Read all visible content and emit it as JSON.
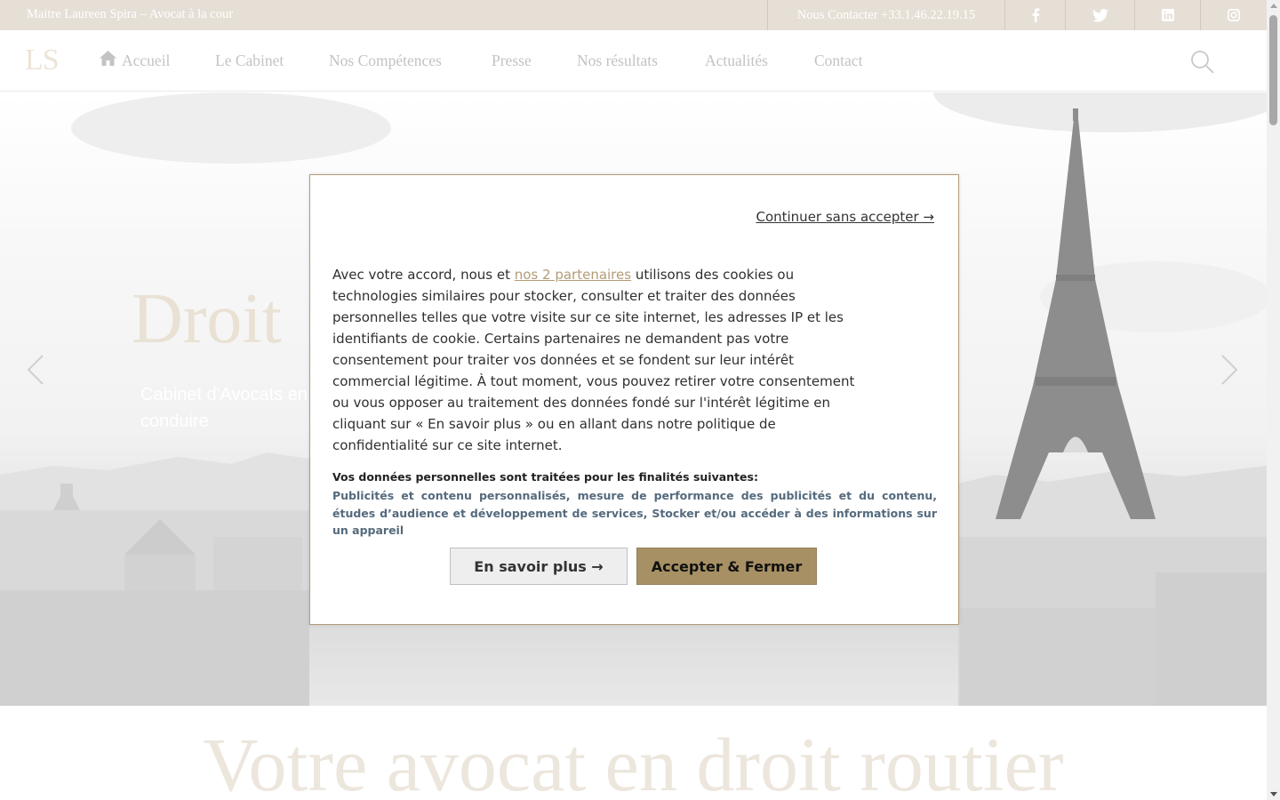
{
  "topbar": {
    "tagline": "Maitre Laureen Spira – Avocat à la cour",
    "contact": "Nous Contacter +33.1.46.22.19.15",
    "social": [
      "facebook-icon",
      "twitter-icon",
      "linkedin-icon",
      "instagram-icon"
    ]
  },
  "header": {
    "logo": "LS",
    "nav": [
      "Accueil",
      "Le Cabinet",
      "Nos Compétences",
      "Presse",
      "Nos résultats",
      "Actualités",
      "Contact"
    ],
    "search_icon": "search-icon"
  },
  "hero": {
    "title": "Droit",
    "subtitle": "Cabinet d'Avocats en conduire",
    "prev_icon": "chevron-left-icon",
    "next_icon": "chevron-right-icon"
  },
  "section": {
    "heading": "Votre avocat en droit routier"
  },
  "cookie_modal": {
    "continue_label": "Continuer sans accepter →",
    "text_before_link": "Avec votre accord, nous et ",
    "partners_link": "nos 2 partenaires",
    "text_after_link": " utilisons des cookies ou technologies similaires pour stocker, consulter et traiter des données personnelles telles que votre visite sur ce site internet, les adresses IP et les identifiants de cookie. Certains partenaires ne demandent pas votre consentement pour traiter vos données et se fondent sur leur intérêt commercial légitime. À tout moment, vous pouvez retirer votre consentement ou vous opposer au traitement des données fondé sur l'intérêt légitime en cliquant sur « En savoir plus » ou en allant dans notre politique de confidentialité sur ce site internet.",
    "purposes_title": "Vos données personnelles sont traitées pour les finalités suivantes:",
    "purposes_list": "Publicités et contenu personnalisés, mesure de performance des publicités et du contenu, études d’audience et développement de services, Stocker et/ou accéder à des informations sur un appareil",
    "learn_more_label": "En savoir plus →",
    "accept_label": "Accepter & Fermer"
  },
  "colors": {
    "accent": "#a79063",
    "link": "#b39c76",
    "topbar_bg": "#e6dfd6"
  }
}
